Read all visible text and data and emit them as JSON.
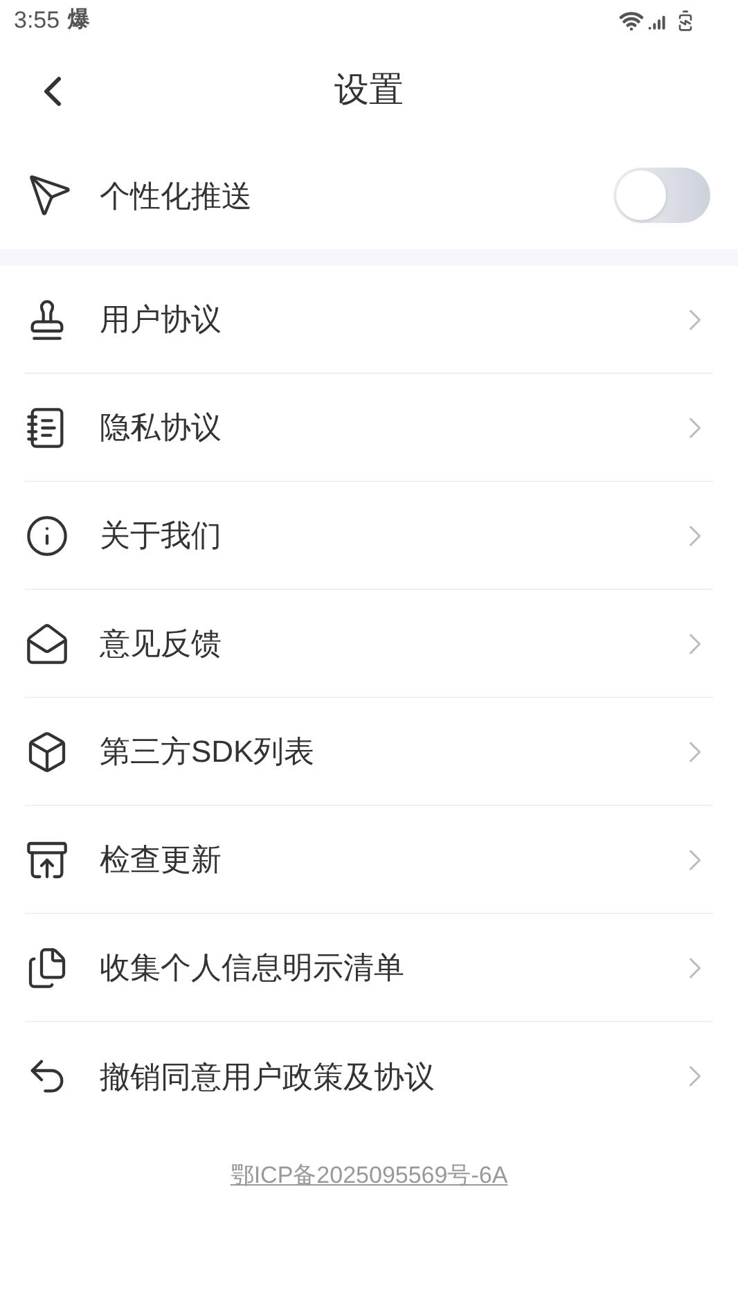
{
  "status_bar": {
    "time": "3:55",
    "notification": "爆"
  },
  "header": {
    "title": "设置"
  },
  "push": {
    "label": "个性化推送",
    "on": false
  },
  "menu": [
    {
      "label": "用户协议"
    },
    {
      "label": "隐私协议"
    },
    {
      "label": "关于我们"
    },
    {
      "label": "意见反馈"
    },
    {
      "label": "第三方SDK列表"
    },
    {
      "label": "检查更新"
    },
    {
      "label": "收集个人信息明示清单"
    },
    {
      "label": "撤销同意用户政策及协议"
    }
  ],
  "footer": {
    "icp": "鄂ICP备2025095569号-6A"
  }
}
